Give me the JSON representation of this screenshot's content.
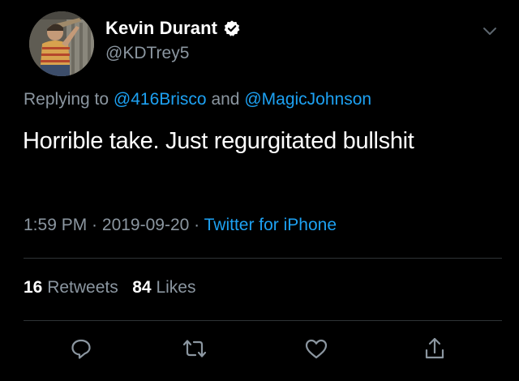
{
  "author": {
    "display_name": "Kevin Durant",
    "handle": "@KDTrey5",
    "verified": true
  },
  "reply": {
    "prefix": "Replying to ",
    "mention_1": "@416Brisco",
    "joiner": " and ",
    "mention_2": "@MagicJohnson"
  },
  "tweet": {
    "text": "Horrible take. Just regurgitated bullshit"
  },
  "meta": {
    "time": "1:59 PM",
    "sep1": " · ",
    "date": "2019-09-20",
    "sep2": " · ",
    "source": "Twitter for iPhone"
  },
  "stats": {
    "retweets_count": "16",
    "retweets_label": " Retweets",
    "likes_count": "84",
    "likes_label": " Likes"
  },
  "icons": {
    "reply": "reply-icon",
    "retweet": "retweet-icon",
    "like": "heart-icon",
    "share": "share-icon",
    "menu": "chevron-down-icon",
    "verified": "verified-badge-icon"
  },
  "colors": {
    "background": "#000000",
    "text": "#ffffff",
    "secondary": "#8b96a0",
    "link": "#1da1f2",
    "divider": "#2f3336"
  }
}
